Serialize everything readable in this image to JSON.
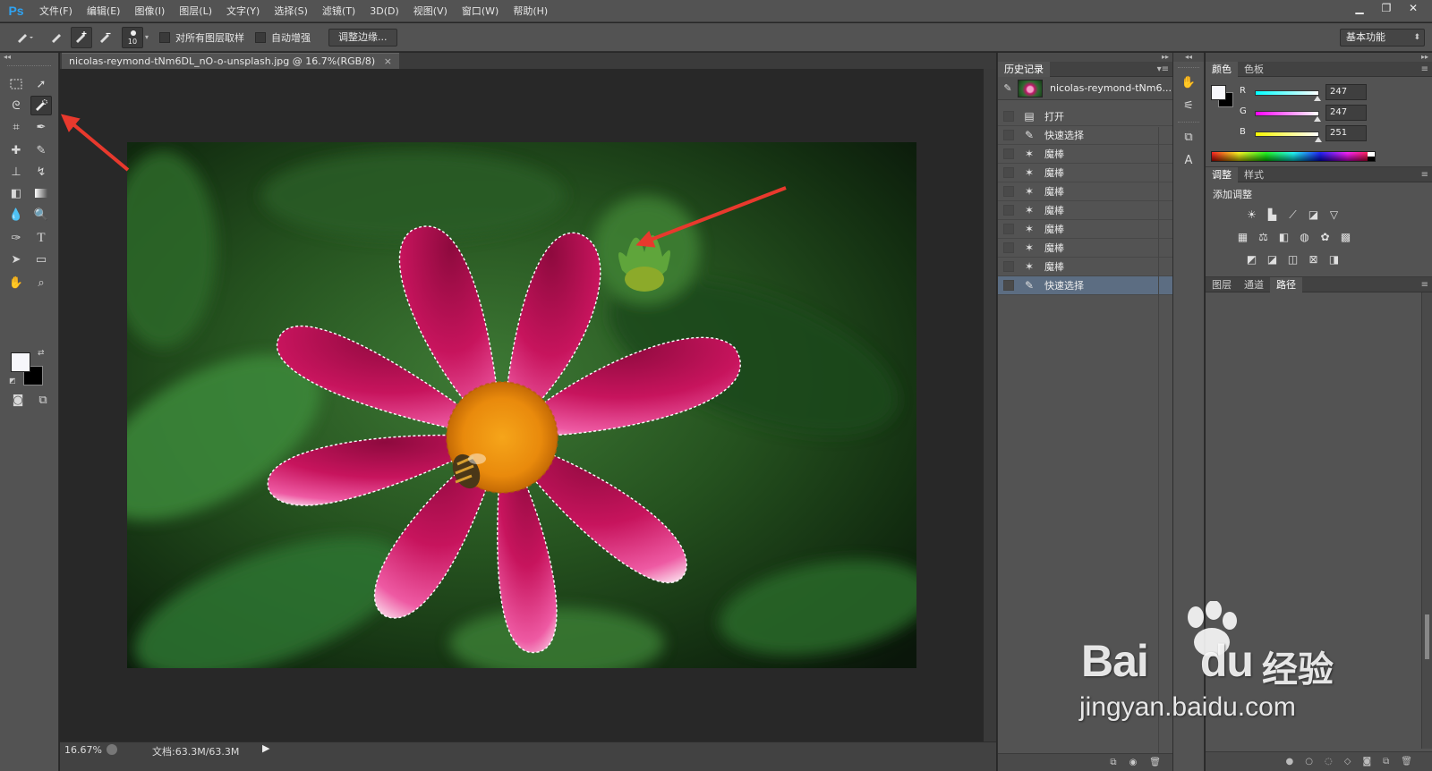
{
  "app": {
    "logo": "Ps"
  },
  "menu": [
    "文件(F)",
    "编辑(E)",
    "图像(I)",
    "图层(L)",
    "文字(Y)",
    "选择(S)",
    "滤镜(T)",
    "3D(D)",
    "视图(V)",
    "窗口(W)",
    "帮助(H)"
  ],
  "options": {
    "brush_size": "10",
    "sample_all_layers": "对所有图层取样",
    "auto_enhance": "自动增强",
    "refine_edge_button": "调整边缘...",
    "workspace": "基本功能"
  },
  "document": {
    "tab_title": "nicolas-reymond-tNm6DL_nO-o-unsplash.jpg @ 16.7%(RGB/8)",
    "close": "×"
  },
  "status": {
    "zoom": "16.67%",
    "doc_info": "文档:63.3M/63.3M"
  },
  "history": {
    "tabs": [
      "历史记录"
    ],
    "snapshot_label": "nicolas-reymond-tNm6...",
    "items": [
      {
        "label": "打开",
        "icon": "open-document-icon"
      },
      {
        "label": "快速选择",
        "icon": "quick-selection-icon"
      },
      {
        "label": "魔棒",
        "icon": "magic-wand-icon"
      },
      {
        "label": "魔棒",
        "icon": "magic-wand-icon"
      },
      {
        "label": "魔棒",
        "icon": "magic-wand-icon"
      },
      {
        "label": "魔棒",
        "icon": "magic-wand-icon"
      },
      {
        "label": "魔棒",
        "icon": "magic-wand-icon"
      },
      {
        "label": "魔棒",
        "icon": "magic-wand-icon"
      },
      {
        "label": "魔棒",
        "icon": "magic-wand-icon"
      },
      {
        "label": "快速选择",
        "icon": "quick-selection-icon",
        "selected": true
      }
    ]
  },
  "color_panel": {
    "tabs": [
      "颜色",
      "色板"
    ],
    "r": {
      "label": "R",
      "value": "247",
      "level": 0.969,
      "from": "#00ffff",
      "to": "#ffffff"
    },
    "g": {
      "label": "G",
      "value": "247",
      "level": 0.969,
      "from": "#ff00ff",
      "to": "#ffffff"
    },
    "b": {
      "label": "B",
      "value": "251",
      "level": 0.984,
      "from": "#f7f700",
      "to": "#ffffff"
    },
    "foreground": "#f7f7fb",
    "background": "#000000"
  },
  "adjustments_panel": {
    "tabs": [
      "调整",
      "样式"
    ],
    "title": "添加调整"
  },
  "layers_panel": {
    "tabs": [
      "图层",
      "通道",
      "路径"
    ],
    "active_tab": "路径"
  },
  "watermark": {
    "brand": "Bai",
    "brand_suffix": "du",
    "cn": "经验",
    "url": "jingyan.baidu.com"
  }
}
